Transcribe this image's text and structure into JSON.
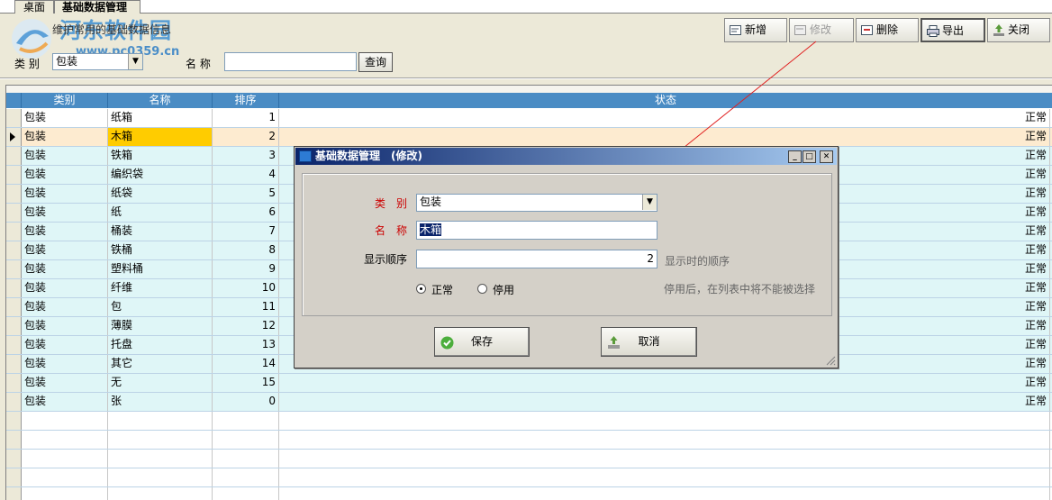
{
  "tabs": [
    "桌面",
    "基础数据管理"
  ],
  "watermark": {
    "title": "河东软件园",
    "url": "www.pc0359.cn"
  },
  "subtitle": "维护常用的基础数据信息",
  "toolbar": {
    "add": "新增",
    "edit": "修改",
    "delete": "删除",
    "export": "导出",
    "close": "关闭"
  },
  "filter": {
    "category_label": "类 别",
    "category_value": "包装",
    "name_label": "名 称",
    "name_value": "",
    "query_button": "查询"
  },
  "grid": {
    "columns": [
      "类别",
      "名称",
      "排序",
      "状态"
    ],
    "rows": [
      {
        "category": "包装",
        "name": "纸箱",
        "order": "1",
        "status": "正常"
      },
      {
        "category": "包装",
        "name": "木箱",
        "order": "2",
        "status": "正常"
      },
      {
        "category": "包装",
        "name": "铁箱",
        "order": "3",
        "status": "正常"
      },
      {
        "category": "包装",
        "name": "编织袋",
        "order": "4",
        "status": "正常"
      },
      {
        "category": "包装",
        "name": "纸袋",
        "order": "5",
        "status": "正常"
      },
      {
        "category": "包装",
        "name": "纸",
        "order": "6",
        "status": "正常"
      },
      {
        "category": "包装",
        "name": "桶装",
        "order": "7",
        "status": "正常"
      },
      {
        "category": "包装",
        "name": "铁桶",
        "order": "8",
        "status": "正常"
      },
      {
        "category": "包装",
        "name": "塑料桶",
        "order": "9",
        "status": "正常"
      },
      {
        "category": "包装",
        "name": "纤维",
        "order": "10",
        "status": "正常"
      },
      {
        "category": "包装",
        "name": "包",
        "order": "11",
        "status": "正常"
      },
      {
        "category": "包装",
        "name": "薄膜",
        "order": "12",
        "status": "正常"
      },
      {
        "category": "包装",
        "name": "托盘",
        "order": "13",
        "status": "正常"
      },
      {
        "category": "包装",
        "name": "其它",
        "order": "14",
        "status": "正常"
      },
      {
        "category": "包装",
        "name": "无",
        "order": "15",
        "status": "正常"
      },
      {
        "category": "包装",
        "name": "张",
        "order": "0",
        "status": "正常"
      }
    ]
  },
  "dialog": {
    "title": "基础数据管理　(修改)",
    "category_label": "类　别",
    "category_value": "包装",
    "name_label": "名　称",
    "name_value": "木箱",
    "order_label": "显示顺序",
    "order_value": "2",
    "order_hint": "显示时的顺序",
    "radio_normal": "正常",
    "radio_disabled": "停用",
    "disable_hint": "停用后，在列表中将不能被选择",
    "save": "保存",
    "cancel": "取消"
  }
}
